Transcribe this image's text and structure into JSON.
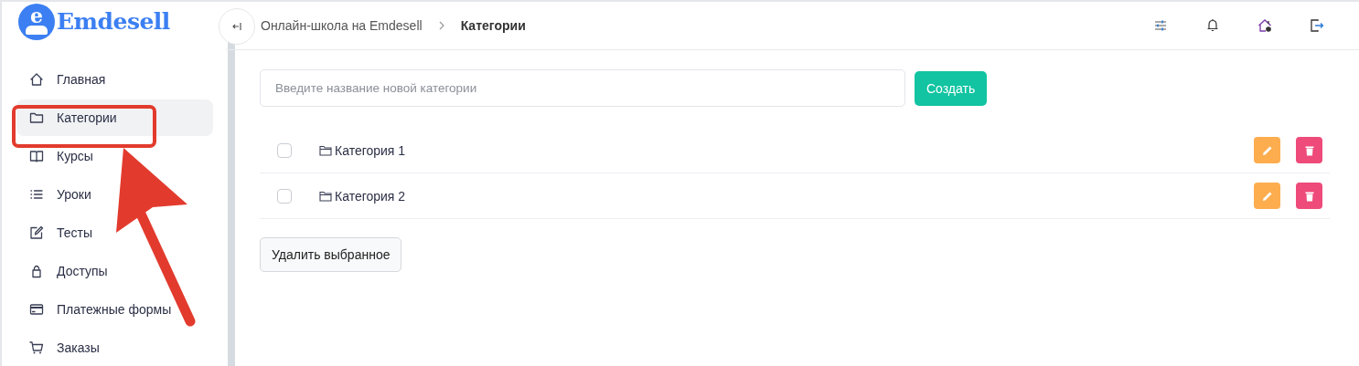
{
  "logo": {
    "mark": "e",
    "name": "Emdesell"
  },
  "sidebar": {
    "items": [
      {
        "label": "Главная",
        "selected": false
      },
      {
        "label": "Категории",
        "selected": true
      },
      {
        "label": "Курсы",
        "selected": false
      },
      {
        "label": "Уроки",
        "selected": false
      },
      {
        "label": "Тесты",
        "selected": false
      },
      {
        "label": "Доступы",
        "selected": false
      },
      {
        "label": "Платежные формы",
        "selected": false
      },
      {
        "label": "Заказы",
        "selected": false
      }
    ]
  },
  "breadcrumbs": [
    {
      "label": "Онлайн-школа на Emdesell",
      "current": false
    },
    {
      "label": "Категории",
      "current": true
    }
  ],
  "new_category": {
    "placeholder": "Введите название новой категории",
    "button": "Создать"
  },
  "categories": [
    {
      "name": "Категория 1",
      "checked": false
    },
    {
      "name": "Категория 2",
      "checked": false
    }
  ],
  "delete_selected": "Удалить выбранное",
  "annotation": {
    "highlight": true
  }
}
